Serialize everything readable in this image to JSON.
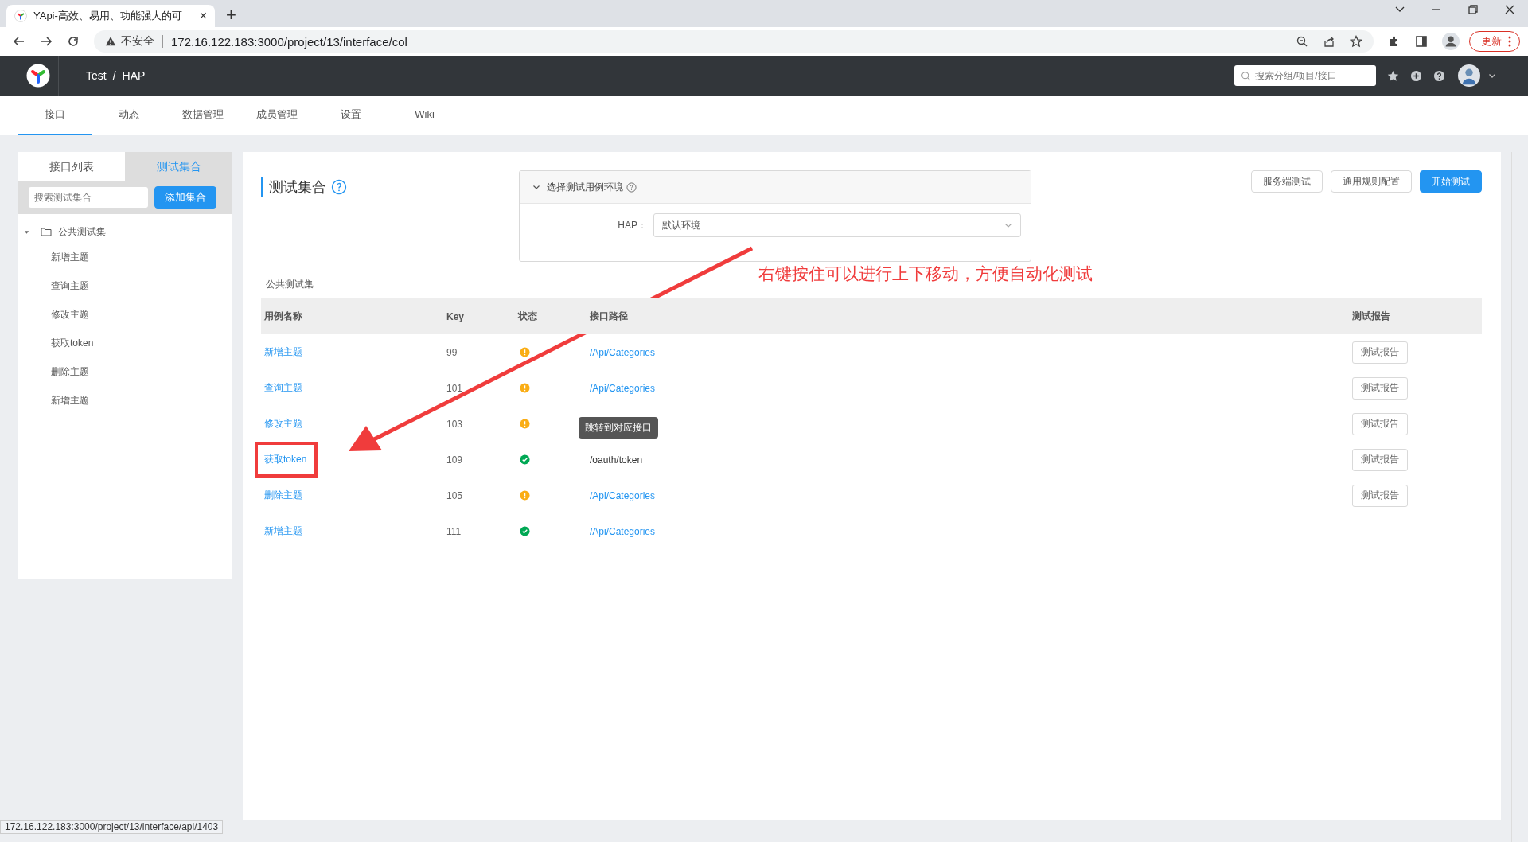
{
  "browser": {
    "tab_title": "YApi-高效、易用、功能强大的可",
    "tab_close": "×",
    "new_tab": "+",
    "security_label": "不安全",
    "url": "172.16.122.183:3000/project/13/interface/col",
    "update_button": "更新"
  },
  "header": {
    "breadcrumb": [
      {
        "label": "Test"
      },
      {
        "label": "/"
      },
      {
        "label": "HAP"
      }
    ],
    "search": {
      "placeholder": "搜索分组/项目/接口"
    }
  },
  "nav_tabs": [
    {
      "label": "接口",
      "selected": true
    },
    {
      "label": "动态",
      "selected": false
    },
    {
      "label": "数据管理",
      "selected": false
    },
    {
      "label": "成员管理",
      "selected": false
    },
    {
      "label": "设置",
      "selected": false
    },
    {
      "label": "Wiki",
      "selected": false
    }
  ],
  "sidebar": {
    "tabs": [
      {
        "label": "接口列表",
        "selected": false
      },
      {
        "label": "测试集合",
        "selected": true
      }
    ],
    "search": {
      "placeholder": "搜索测试集合"
    },
    "add_button": "添加集合",
    "tree": [
      {
        "label": "公共测试集",
        "expanded": true,
        "children": [
          {
            "label": "新增主题"
          },
          {
            "label": "查询主题"
          },
          {
            "label": "修改主题"
          },
          {
            "label": "获取token"
          },
          {
            "label": "删除主题"
          },
          {
            "label": "新增主题"
          }
        ]
      }
    ]
  },
  "main": {
    "title": "测试集合",
    "environment": {
      "header": "选择测试用例环境",
      "expanded": true,
      "label": "HAP：",
      "value": "默认环境"
    },
    "buttons": [
      {
        "label": "服务端测试",
        "kind": "default"
      },
      {
        "label": "通用规则配置",
        "kind": "default"
      },
      {
        "label": "开始测试",
        "kind": "primary"
      }
    ],
    "collection_name": "公共测试集",
    "table": {
      "columns": [
        "用例名称",
        "Key",
        "状态",
        "接口路径",
        "测试报告"
      ],
      "rows": [
        {
          "name": "新增主题",
          "key": "99",
          "passed": false,
          "path": "/Api/Categories",
          "path_link": true,
          "report": "测试报告"
        },
        {
          "name": "查询主题",
          "key": "101",
          "passed": false,
          "path": "/Api/Categories",
          "path_link": true,
          "report": "测试报告"
        },
        {
          "name": "修改主题",
          "key": "103",
          "passed": false,
          "report": "测试报告"
        },
        {
          "name": "获取token",
          "key": "109",
          "passed": true,
          "path": "/oauth/token",
          "path_link": false,
          "tooltip": "跳转到对应接口",
          "report": "测试报告",
          "highlighted": true
        },
        {
          "name": "删除主题",
          "key": "105",
          "passed": false,
          "path": "/Api/Categories",
          "path_link": true,
          "report": "测试报告"
        },
        {
          "name": "新增主题",
          "key": "111",
          "passed": true,
          "path": "/Api/Categories",
          "path_link": true
        }
      ]
    }
  },
  "annotation": {
    "text": "右键按住可以进行上下移动，方便自动化测试"
  },
  "status_url": "172.16.122.183:3000/project/13/interface/api/1403"
}
